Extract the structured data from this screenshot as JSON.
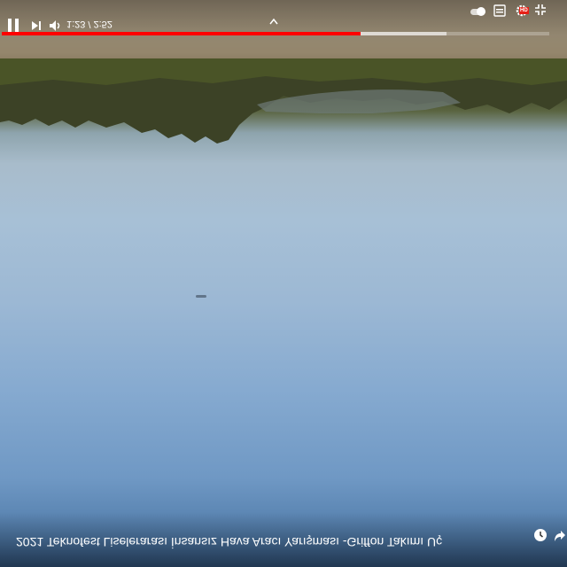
{
  "player": {
    "time": {
      "current": "1:23",
      "separator": "/",
      "duration": "2:52"
    },
    "progress": {
      "played_fraction": 0.655,
      "buffered_fraction": 0.812
    },
    "hd_badge": "HD",
    "title": "2021 Teknofest Liselerarası İnsansız Hava Aracı Yarışması -Griffon Takımı Uçuş Kanıt Videosu"
  },
  "colors": {
    "progress_played": "#ff0000",
    "hd_badge": "#e62117",
    "controls_icon": "#ffffff"
  },
  "icons": {
    "play_pause": "pause-icon",
    "next": "next-icon",
    "volume": "volume-icon",
    "chevron": "chevron-up-icon",
    "autoplay": "toggle-icon",
    "subtitles": "subtitles-icon",
    "settings": "gear-icon",
    "fullscreen": "exit-fullscreen-icon",
    "watch_later": "clock-icon",
    "share": "share-icon"
  }
}
